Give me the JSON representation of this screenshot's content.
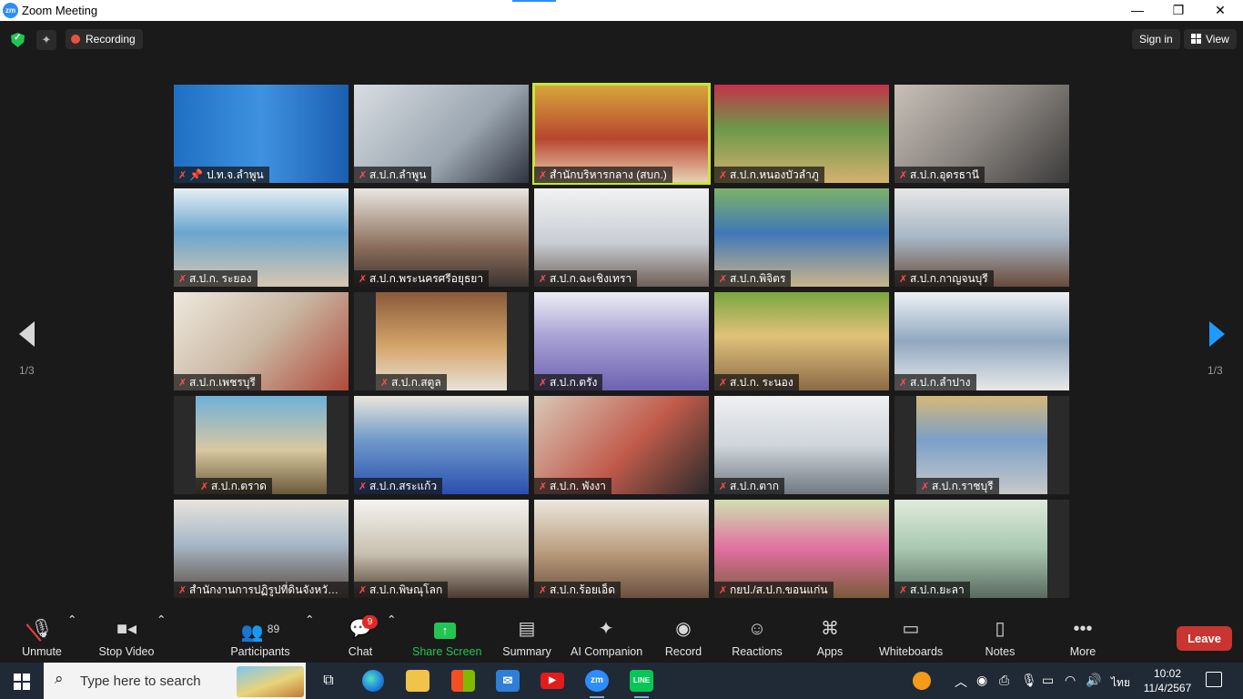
{
  "window": {
    "app_logo": "zm",
    "title": "Zoom Meeting",
    "minimize": "—",
    "restore": "❐",
    "close": "✕"
  },
  "meeting_bar": {
    "recording_label": "Recording",
    "signin_label": "Sign in",
    "view_label": "View"
  },
  "gallery": {
    "page_left": "1/3",
    "page_right": "1/3",
    "active_speaker_index": 2,
    "tiles": [
      {
        "name": "ป.ท.จ.ลำพูน",
        "pinned": true
      },
      {
        "name": "ส.ป.ก.ลำพูน"
      },
      {
        "name": "สำนักบริหารกลาง (สบก.)",
        "active": true
      },
      {
        "name": "ส.ป.ก.หนองบัวลำภู"
      },
      {
        "name": "ส.ป.ก.อุดรธานี"
      },
      {
        "name": "ส.ป.ก. ระยอง"
      },
      {
        "name": "ส.ป.ก.พระนครศรีอยุธยา"
      },
      {
        "name": "ส.ป.ก.ฉะเชิงเทรา"
      },
      {
        "name": "ส.ป.ก.พิจิตร"
      },
      {
        "name": "ส.ป.ก.กาญจนบุรี"
      },
      {
        "name": "ส.ป.ก.เพชรบุรี"
      },
      {
        "name": "ส.ป.ก.สตูล"
      },
      {
        "name": "ส.ป.ก.ตรัง"
      },
      {
        "name": "ส.ป.ก. ระนอง"
      },
      {
        "name": "ส.ป.ก.ลำปาง"
      },
      {
        "name": "ส.ป.ก.ตราด"
      },
      {
        "name": "ส.ป.ก.สระแก้ว"
      },
      {
        "name": "ส.ป.ก. พังงา"
      },
      {
        "name": "ส.ป.ก.ตาก"
      },
      {
        "name": "ส.ป.ก.ราชบุรี"
      },
      {
        "name": "สำนักงานการปฏิรูปที่ดินจังหวัดน..."
      },
      {
        "name": "ส.ป.ก.พิษณุโลก"
      },
      {
        "name": "ส.ป.ก.ร้อยเอ็ด"
      },
      {
        "name": "กยป./ส.ป.ก.ขอนแก่น"
      },
      {
        "name": "ส.ป.ก.ยะลา"
      }
    ]
  },
  "toolbar": {
    "unmute": "Unmute",
    "stop_video": "Stop Video",
    "participants": "Participants",
    "participants_count": "89",
    "chat": "Chat",
    "chat_badge": "9",
    "share_screen": "Share Screen",
    "summary": "Summary",
    "ai_companion": "AI Companion",
    "record": "Record",
    "reactions": "Reactions",
    "apps": "Apps",
    "whiteboards": "Whiteboards",
    "notes": "Notes",
    "more": "More",
    "leave": "Leave"
  },
  "taskbar": {
    "search_placeholder": "Type here to search",
    "zoom_app": "zm",
    "line_app": "LINE",
    "language": "ไทย",
    "time": "10:02",
    "date": "11/4/2567"
  },
  "colors": {
    "accent": "#2d8cff",
    "share_green": "#23c552",
    "leave_red": "#c93531",
    "active_speaker": "#c8e63a",
    "muted_red": "#ff4d4d"
  }
}
